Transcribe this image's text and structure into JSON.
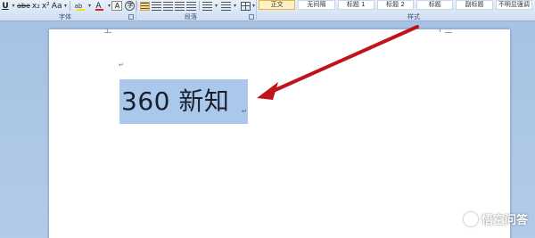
{
  "ribbon": {
    "toolbar": {
      "underline_label": "U",
      "strike_label": "abe",
      "subscript_label": "x₂",
      "superscript_label": "x²",
      "change_case_label": "Aa",
      "highlight_label": "ab",
      "font_color_label": "A",
      "char_shading_label": "A",
      "enclose_label": "字"
    },
    "styles": [
      {
        "label": "正文",
        "active": true
      },
      {
        "label": "无间隔",
        "active": false
      },
      {
        "label": "标题 1",
        "active": false
      },
      {
        "label": "标题 2",
        "active": false
      },
      {
        "label": "标题",
        "active": false
      },
      {
        "label": "副标题",
        "active": false
      },
      {
        "label": "不明显强调",
        "active": false
      }
    ],
    "groups": {
      "font": "字体",
      "paragraph": "段落",
      "styles": "样式"
    }
  },
  "document": {
    "selected_text": "360 新知"
  },
  "annotation": {
    "arrow_color": "#c0141c"
  },
  "watermark": {
    "text": "悟空问答"
  },
  "colors": {
    "selection": "#a9c8ec",
    "doc_background": "#a9c4e4",
    "ribbon": "#dbe6f4"
  }
}
